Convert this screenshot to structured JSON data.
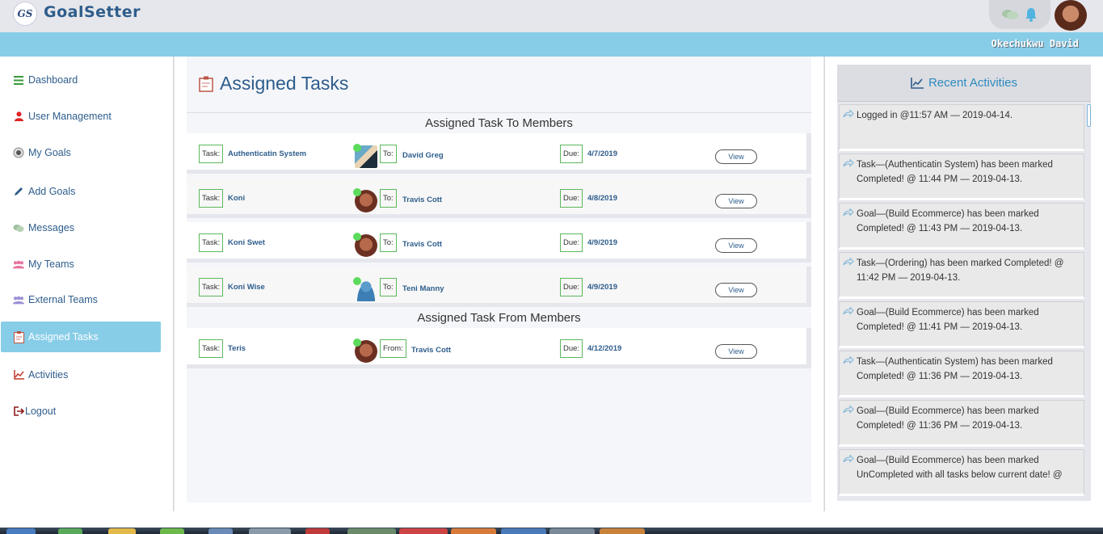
{
  "app": {
    "logo_text": "GS",
    "name": "GoalSetter",
    "username": "Okechukwu David"
  },
  "colors": {
    "accent": "#87cde8",
    "brand": "#2e5d8c",
    "tag_border": "#5cb85c",
    "activity_title": "#2e8bc0"
  },
  "sidebar": {
    "items": [
      {
        "label": "Dashboard",
        "icon": "bars-icon"
      },
      {
        "label": "User Management",
        "icon": "user-icon"
      },
      {
        "label": "My Goals",
        "icon": "target-icon"
      },
      {
        "label": "Add Goals",
        "icon": "pencil-icon"
      },
      {
        "label": "Messages",
        "icon": "chat-icon"
      },
      {
        "label": "My Teams",
        "icon": "team-icon"
      },
      {
        "label": "External Teams",
        "icon": "team-icon"
      },
      {
        "label": "Assigned Tasks",
        "icon": "clipboard-icon",
        "active": true
      },
      {
        "label": "Activities",
        "icon": "line-chart-icon"
      },
      {
        "label": "Logout",
        "icon": "logout-icon"
      }
    ]
  },
  "main": {
    "title": "Assigned Tasks",
    "to_section": "Assigned Task To Members",
    "from_section": "Assigned Task From Members",
    "labels": {
      "task": "Task:",
      "to": "To:",
      "from": "From:",
      "due": "Due:",
      "view": "View"
    },
    "to_tasks": [
      {
        "task": "Authenticatin System",
        "member": "David Greg",
        "due": "4/7/2019",
        "avatar": "photo"
      },
      {
        "task": "Koni",
        "member": "Travis Cott",
        "due": "4/8/2019",
        "avatar": "girl"
      },
      {
        "task": "Koni Swet",
        "member": "Travis Cott",
        "due": "4/9/2019",
        "avatar": "girl"
      },
      {
        "task": "Koni Wise",
        "member": "Teni Manny",
        "due": "4/9/2019",
        "avatar": "default"
      }
    ],
    "from_tasks": [
      {
        "task": "Teris",
        "member": "Travis Cott",
        "due": "4/12/2019",
        "avatar": "girl"
      }
    ]
  },
  "activities": {
    "title": "Recent Activities",
    "items": [
      "Logged in @11:57 AM — 2019-04-14.",
      "Task—(Authenticatin System) has been marked Completed! @ 11:44 PM — 2019-04-13.",
      "Goal—(Build Ecommerce) has been marked Completed! @ 11:43 PM — 2019-04-13.",
      "Task—(Ordering) has been marked Completed! @ 11:42 PM — 2019-04-13.",
      "Goal—(Build Ecommerce) has been marked Completed! @ 11:41 PM — 2019-04-13.",
      "Task—(Authenticatin System) has been marked Completed! @ 11:36 PM — 2019-04-13.",
      "Goal—(Build Ecommerce) has been marked Completed! @ 11:36 PM — 2019-04-13.",
      "Goal—(Build Ecommerce) has been marked UnCompleted with all tasks below current date! @"
    ]
  }
}
